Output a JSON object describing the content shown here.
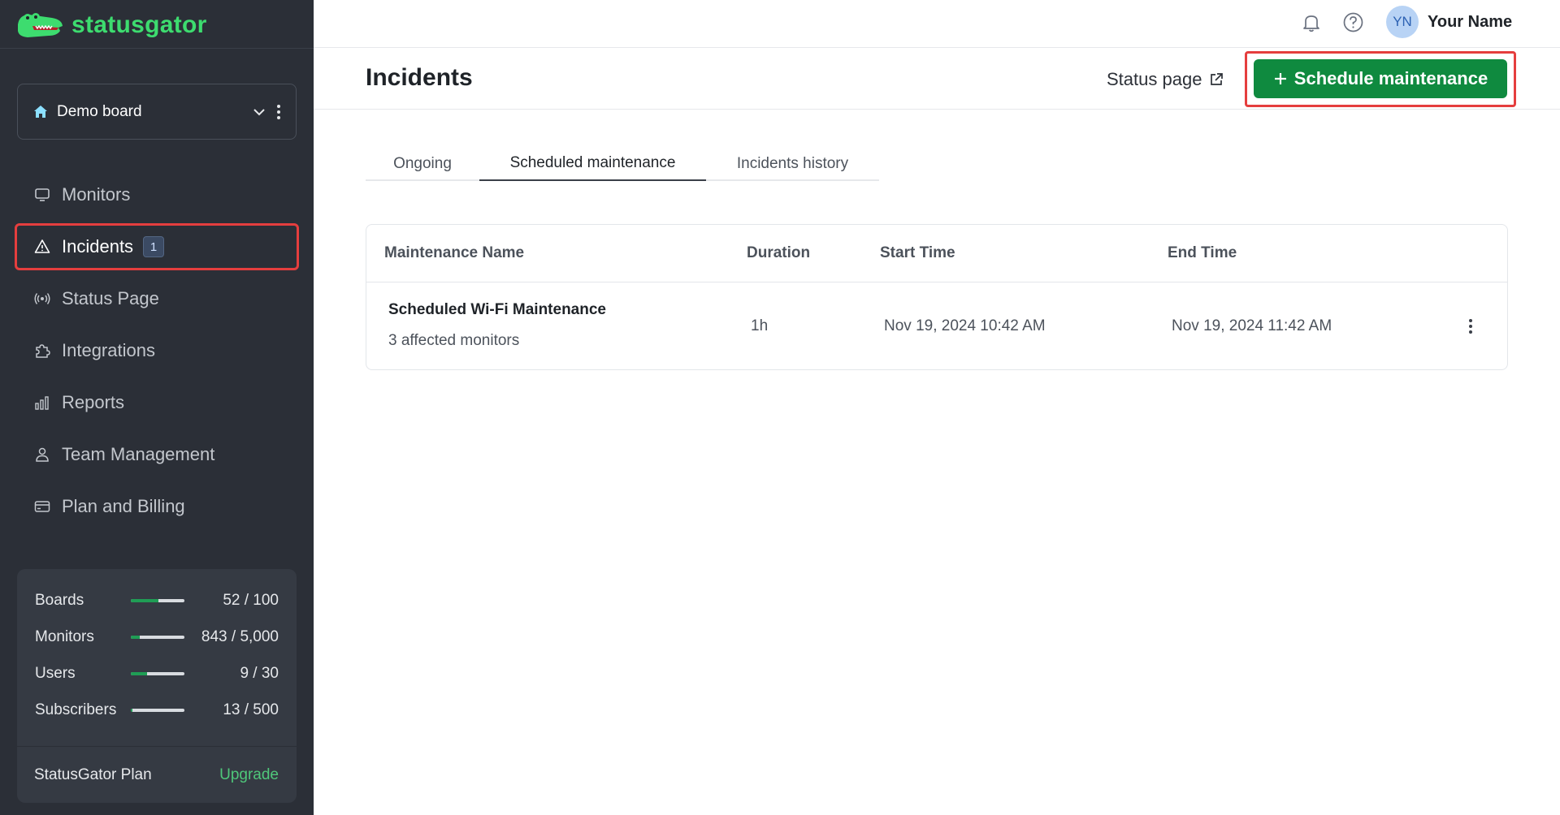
{
  "brand": {
    "name": "statusgator",
    "accent": "#3ddc6f"
  },
  "board": {
    "name": "Demo board"
  },
  "nav": {
    "items": [
      {
        "label": "Monitors",
        "icon": "monitor-icon"
      },
      {
        "label": "Incidents",
        "icon": "alert-triangle-icon",
        "badge": "1",
        "active": true
      },
      {
        "label": "Status Page",
        "icon": "broadcast-icon"
      },
      {
        "label": "Integrations",
        "icon": "puzzle-icon"
      },
      {
        "label": "Reports",
        "icon": "bar-chart-icon"
      },
      {
        "label": "Team Management",
        "icon": "user-icon"
      },
      {
        "label": "Plan and Billing",
        "icon": "credit-card-icon"
      }
    ]
  },
  "usage": {
    "rows": [
      {
        "label": "Boards",
        "value": "52 / 100",
        "fraction": 0.52
      },
      {
        "label": "Monitors",
        "value": "843 / 5,000",
        "fraction": 0.17
      },
      {
        "label": "Users",
        "value": "9 / 30",
        "fraction": 0.3
      },
      {
        "label": "Subscribers",
        "value": "13 / 500",
        "fraction": 0.03
      }
    ],
    "plan_label": "StatusGator Plan",
    "upgrade_label": "Upgrade"
  },
  "topbar": {
    "avatar_initials": "YN",
    "user_name": "Your Name"
  },
  "header": {
    "title": "Incidents",
    "status_page_link": "Status page",
    "schedule_button": "Schedule maintenance"
  },
  "tabs": [
    {
      "label": "Ongoing"
    },
    {
      "label": "Scheduled maintenance",
      "active": true
    },
    {
      "label": "Incidents history"
    }
  ],
  "table": {
    "columns": [
      "Maintenance Name",
      "Duration",
      "Start Time",
      "End Time"
    ],
    "rows": [
      {
        "name": "Scheduled Wi-Fi Maintenance",
        "sub": "3 affected monitors",
        "duration": "1h",
        "start": "Nov 19, 2024 10:42 AM",
        "end": "Nov 19, 2024 11:42 AM"
      }
    ]
  },
  "colors": {
    "sidebar_bg": "#2b2f37",
    "primary_button": "#0f8a3f",
    "highlight": "#e53e3e"
  }
}
